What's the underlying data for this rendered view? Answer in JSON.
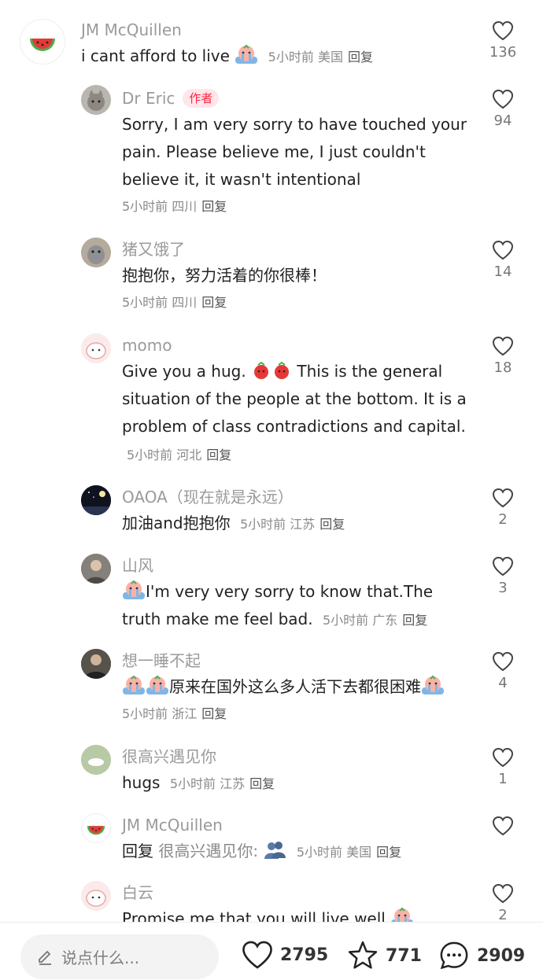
{
  "comments": [
    {
      "user": "JM McQuillen",
      "text": "i cant afford to live",
      "time": "5小时前",
      "location": "美国",
      "reply_label": "回复",
      "likes": "136"
    },
    {
      "user": "Dr Eric",
      "badge": "作者",
      "text": "Sorry, I am very sorry to have touched your pain. Please believe me, I just couldn't believe it, it wasn't intentional",
      "time": "5小时前",
      "location": "四川",
      "reply_label": "回复",
      "likes": "94"
    },
    {
      "user": "猪又饿了",
      "text": "抱抱你，努力活着的你很棒！",
      "time": "5小时前",
      "location": "四川",
      "reply_label": "回复",
      "likes": "14"
    },
    {
      "user": "momo",
      "text_a": "Give you a hug.",
      "text_b": "This is the general situation of the people at the bottom. It is a problem of class contradictions and capital.",
      "time": "5小时前",
      "location": "河北",
      "reply_label": "回复",
      "likes": "18"
    },
    {
      "user": "OAOA（现在就是永远）",
      "text": "加油and抱抱你",
      "time": "5小时前",
      "location": "江苏",
      "reply_label": "回复",
      "likes": "2"
    },
    {
      "user": "山风",
      "text": "I'm very very sorry to know that.The truth make me feel bad.",
      "time": "5小时前",
      "location": "广东",
      "reply_label": "回复",
      "likes": "3"
    },
    {
      "user": "想一睡不起",
      "text": "原来在国外这么多人活下去都很困难",
      "time": "5小时前",
      "location": "浙江",
      "reply_label": "回复",
      "likes": "4"
    },
    {
      "user": "很高兴遇见你",
      "text": "hugs",
      "time": "5小时前",
      "location": "江苏",
      "reply_label": "回复",
      "likes": "1"
    },
    {
      "user": "JM McQuillen",
      "reply_prefix": "回复",
      "reply_target": "很高兴遇见你:",
      "time": "5小时前",
      "location": "美国",
      "reply_label": "回复",
      "likes": ""
    },
    {
      "user": "白云",
      "text": "Promise me that you will live well",
      "likes": "2"
    }
  ],
  "bottom": {
    "input_placeholder": "说点什么...",
    "likes": "2795",
    "stars": "771",
    "comments": "2909"
  },
  "colors": {
    "accent": "#ff2442",
    "muted": "#9a9a9a"
  }
}
